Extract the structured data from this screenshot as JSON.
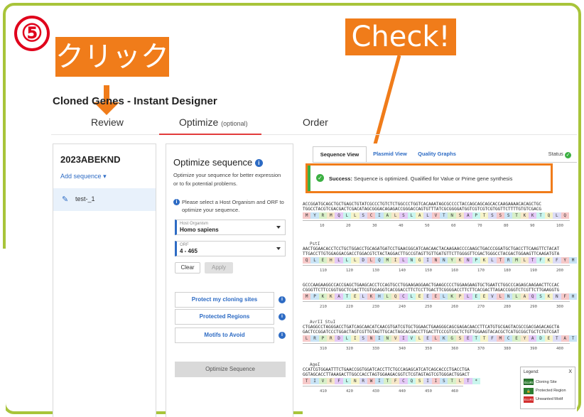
{
  "annotations": {
    "step_number": "⑤",
    "click_label": "クリック",
    "check_label": "Check!",
    "accent_color": "#f07c1a",
    "frame_color": "#a8c43a"
  },
  "app": {
    "title": "Cloned Genes - Instant Designer"
  },
  "tabs": {
    "review": "Review",
    "optimize": "Optimize",
    "optimize_note": "(optional)",
    "order": "Order"
  },
  "sidebar": {
    "project_name": "2023ABEKND",
    "add_sequence": "Add sequence",
    "sequence_item": "test-_1"
  },
  "optimize": {
    "title": "Optimize sequence",
    "description": "Optimize your sequence for better expression or to fix potential problems.",
    "host_note": "Please select a Host Organism and ORF to optimize your sequence.",
    "host_label": "Host Organism",
    "host_value": "Homo sapiens",
    "orf_label": "ORF",
    "orf_value": "4 - 465",
    "clear": "Clear",
    "apply": "Apply",
    "protect_sites": "Protect my cloning sites",
    "protected_regions": "Protected Regions",
    "motifs": "Motifs to Avoid",
    "optimize_button": "Optimize Sequence"
  },
  "viewer": {
    "tabs": [
      "Sequence View",
      "Plasmid View",
      "Quality Graphs"
    ],
    "status": "Status",
    "success_title": "Success:",
    "success_msg": "Sequence is optimized. Qualified for Value or Prime gene synthesis",
    "rows": [
      {
        "site": "",
        "top": "ACCGGATGCAGCTGCTGAGCTGTATCGCCCTGTCTCTGGCCCTGGTCACAAATAGCGCCCCTACCAGCAGCAGCACCAAGAAAACACAGCTGC",
        "bottom": "TGGCCTACGTCGACGACTCGACATAGCGGGACAGAGACCGGGACCAGTGTTTATCGCGGGGATGGTCGTCGTCGTGGTTCTTTTGTGTCGACG",
        "aa": [
          "M",
          "Y",
          "R",
          "M",
          "Q",
          "L",
          "L",
          "S",
          "C",
          "I",
          "A",
          "L",
          "S",
          "L",
          "A",
          "L",
          "V",
          "T",
          "N",
          "S",
          "A",
          "P",
          "T",
          "S",
          "S",
          "S",
          "T",
          "K",
          "K",
          "T",
          "Q",
          "L",
          "Q"
        ],
        "ticks": [
          "10",
          "20",
          "30",
          "40",
          "50",
          "60",
          "70",
          "80",
          "90",
          "100"
        ]
      },
      {
        "site": "PstI",
        "top": "AACTGGAACACCTCCTGCTGGACCTGCAGATGATCCTGAACGGCATCAACAACTACAAGAACCCCAAGCTGACCCGGATGCTGACCTTCAAGTTCTACAT",
        "bottom": "TTGACCTTGTGGAGGACGACCTGGACGTCTACTAGGACTTGCCGTAGTTGTTGATGTTCTTGGGGTTCGACTGGGCCTACGACTGGAAGTTCAAGATGTA",
        "aa": [
          "Q",
          "L",
          "E",
          "H",
          "L",
          "L",
          "L",
          "D",
          "L",
          "Q",
          "M",
          "I",
          "L",
          "N",
          "G",
          "I",
          "N",
          "N",
          "Y",
          "K",
          "N",
          "P",
          "K",
          "L",
          "T",
          "R",
          "M",
          "L",
          "T",
          "F",
          "K",
          "F",
          "Y",
          "M"
        ],
        "ticks": [
          "110",
          "120",
          "130",
          "140",
          "150",
          "160",
          "170",
          "180",
          "190",
          "200"
        ]
      },
      {
        "site": "",
        "top": "GCCCAAGAAGGCCACCGAGCTGAAGCACCTCCAGTGCCTGGAAGAGGAACTGAAGCCCCTGGAAGAAGTGCTGAATCTGGCCCAGAGCAAGAACTTCCAC",
        "bottom": "CGGGTTCTTCCGGTGGCTCGACTTCGTGGAGGTCACGGACCTTCTCCTTGACTTCGGGGACCTTCTTCACGACTTAGACCGGGTCTCGTTCTTGAAGGTG",
        "aa": [
          "M",
          "P",
          "K",
          "K",
          "A",
          "T",
          "E",
          "L",
          "K",
          "H",
          "L",
          "Q",
          "C",
          "L",
          "E",
          "E",
          "E",
          "L",
          "K",
          "P",
          "L",
          "E",
          "E",
          "V",
          "L",
          "N",
          "L",
          "A",
          "Q",
          "S",
          "K",
          "N",
          "F",
          "H"
        ],
        "ticks": [
          "210",
          "220",
          "230",
          "240",
          "250",
          "260",
          "270",
          "280",
          "290",
          "300"
        ]
      },
      {
        "site": "AvrII\nStuI",
        "top": "CTGAGGCCTAGGGACCTGATCAGCAACATCAACGTGATCGTGCTGGAACTGAAGGGCAGCGAGACAACCTTCATGTGCGAGTACGCCGACGAGACAGCTA",
        "bottom": "GACTCCGGATCCCTGGACTAGTCGTTGTAGTTGCACTAGCACGACCTTGACTTCCCGTCGCTCTGTTGGAAGTACACGCTCATGCGGCTGCTCTGTCGAT",
        "aa": [
          "L",
          "R",
          "P",
          "R",
          "D",
          "L",
          "I",
          "S",
          "N",
          "I",
          "N",
          "V",
          "I",
          "V",
          "L",
          "E",
          "L",
          "K",
          "G",
          "S",
          "E",
          "T",
          "T",
          "F",
          "M",
          "C",
          "E",
          "Y",
          "A",
          "D",
          "E",
          "T",
          "A",
          "T"
        ],
        "ticks": [
          "310",
          "320",
          "330",
          "340",
          "350",
          "360",
          "370",
          "380",
          "390",
          "400"
        ]
      },
      {
        "site": "AgeI",
        "top": "CCATCGTGGAATTTCTGAACCGGTGGATCACCTTCTGCCAGAGCATCATCAGCACCCTGACCTGA",
        "bottom": "GGTAGCACCTTAAAGACTTGGCCACCTAGTGGAAGACGGTCTCGTAGTAGTCGTGGGACTGGACT",
        "aa": [
          "T",
          "I",
          "V",
          "E",
          "F",
          "L",
          "N",
          "R",
          "W",
          "I",
          "T",
          "F",
          "C",
          "Q",
          "S",
          "I",
          "I",
          "S",
          "T",
          "L",
          "T",
          "*"
        ],
        "ticks": [
          "410",
          "420",
          "430",
          "440",
          "450",
          "460"
        ]
      }
    ],
    "legend": {
      "title": "Legend:",
      "close": "X",
      "items": [
        "Cloning Site",
        "Protected Region",
        "Unwanted Motif"
      ],
      "swatch_labels": [
        "EcoRI",
        "",
        "EcoRI"
      ]
    }
  }
}
